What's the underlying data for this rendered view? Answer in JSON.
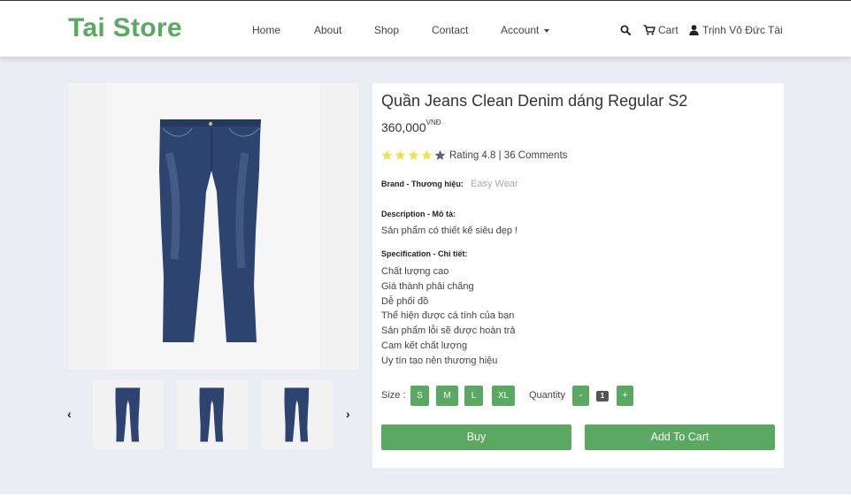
{
  "header": {
    "brand": "Tai Store",
    "nav": [
      "Home",
      "About",
      "Shop",
      "Contact",
      "Account"
    ],
    "cart_label": "Cart",
    "user_name": "Trịnh Võ Đức Tài"
  },
  "gallery": {
    "prev_label": "‹",
    "next_label": "›"
  },
  "product": {
    "title": "Quần Jeans Clean Denim dáng Regular S2",
    "price": "360,000",
    "currency": "VNĐ",
    "rating_filled_stars": 4,
    "rating_text": "Rating 4.8 | 36 Comments",
    "brand_label": "Brand - Thương hiệu:",
    "brand_value": "Easy Wear",
    "description_label": "Description - Mô tả:",
    "description": "Sản phẩm có thiết kế siêu đẹp !",
    "specification_label": "Specification - Chi tiết:",
    "specifications": [
      "Chất lượng cao",
      "Giá thành phải chăng",
      "Dễ phối đồ",
      "Thể hiện được cá tính của bạn",
      "Sản phẩm lỗi sẽ được hoàn trả",
      "Cam kết chất lượng",
      "Uy tín tạo nên thương hiệu"
    ],
    "size_label": "Size :",
    "sizes": [
      "S",
      "M",
      "L",
      "XL"
    ],
    "quantity_label": "Quantity",
    "quantity_minus": "-",
    "quantity_value": "1",
    "quantity_plus": "+",
    "buy_label": "Buy",
    "add_to_cart_label": "Add To Cart"
  },
  "colors": {
    "accent": "#5aa862",
    "background": "#e9edf4",
    "denim": "#2c3f66"
  },
  "icons": [
    "search-icon",
    "cart-icon",
    "user-icon",
    "caret-down-icon",
    "star-icon"
  ]
}
